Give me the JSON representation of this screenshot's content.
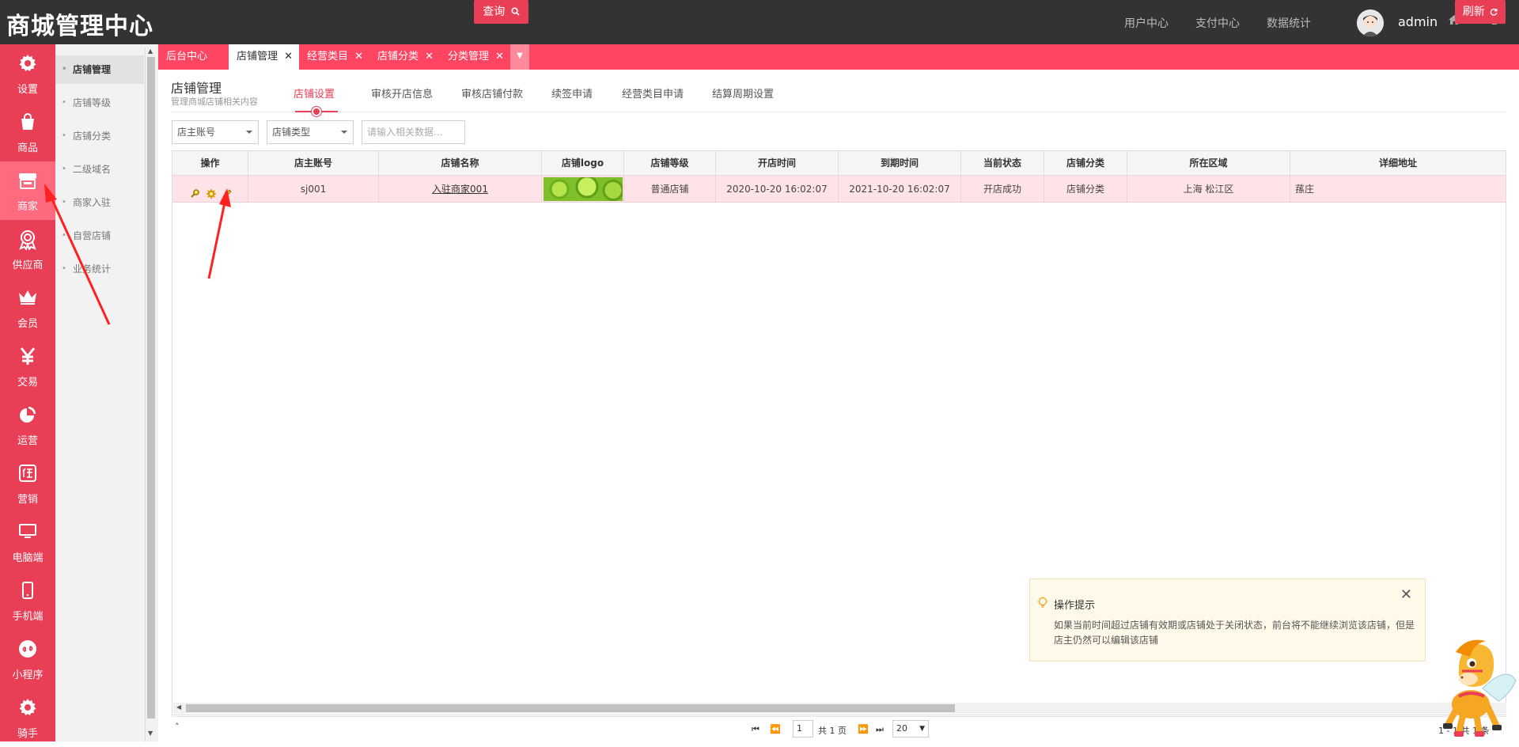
{
  "header": {
    "brand": "商城管理中心",
    "nav": [
      "用户中心",
      "支付中心",
      "数据统计"
    ],
    "user": "admin"
  },
  "leftnav": [
    "设置",
    "商品",
    "商家",
    "供应商",
    "会员",
    "交易",
    "运营",
    "营销",
    "电脑端",
    "手机端",
    "小程序",
    "骑手"
  ],
  "subnav": [
    "店铺管理",
    "店铺等级",
    "店铺分类",
    "二级域名",
    "商家入驻",
    "自营店铺",
    "业务统计"
  ],
  "tabs": [
    "后台中心",
    "店铺管理",
    "经营类目",
    "店铺分类",
    "分类管理"
  ],
  "page": {
    "title": "店铺管理",
    "subtitle": "管理商城店铺相关内容",
    "subtabs": [
      "店铺设置",
      "审核开店信息",
      "审核店铺付款",
      "续签申请",
      "经营类目申请",
      "结算周期设置"
    ]
  },
  "filters": {
    "owner_select": "店主账号",
    "type_select": "店铺类型",
    "search_placeholder": "请输入相关数据...",
    "query_label": "查询",
    "refresh_label": "刷新"
  },
  "table": {
    "headers": [
      "操作",
      "店主账号",
      "店铺名称",
      "店铺logo",
      "店铺等级",
      "开店时间",
      "到期时间",
      "当前状态",
      "店铺分类",
      "所在区域",
      "详细地址"
    ],
    "rows": [
      {
        "account": "sj001",
        "name": "入驻商家001",
        "level": "普通店铺",
        "open_time": "2020-10-20 16:02:07",
        "expire_time": "2021-10-20 16:02:07",
        "status": "开店成功",
        "category": "店铺分类",
        "region": "上海 松江区",
        "address": "蓀庄"
      }
    ]
  },
  "pager": {
    "page": "1",
    "total_pages": "共 1 页",
    "page_size": "20",
    "summary": "1 - 1 共 1 条"
  },
  "tip": {
    "title": "操作提示",
    "body": "如果当前时间超过店铺有效期或店铺处于关闭状态，前台将不能继续浏览该店铺，但是店主仍然可以编辑该店铺"
  },
  "colors": {
    "accent": "#e83e56",
    "tabs_bar": "#ff4561",
    "topbar": "#333333",
    "row_highlight": "#ffe3e8"
  }
}
